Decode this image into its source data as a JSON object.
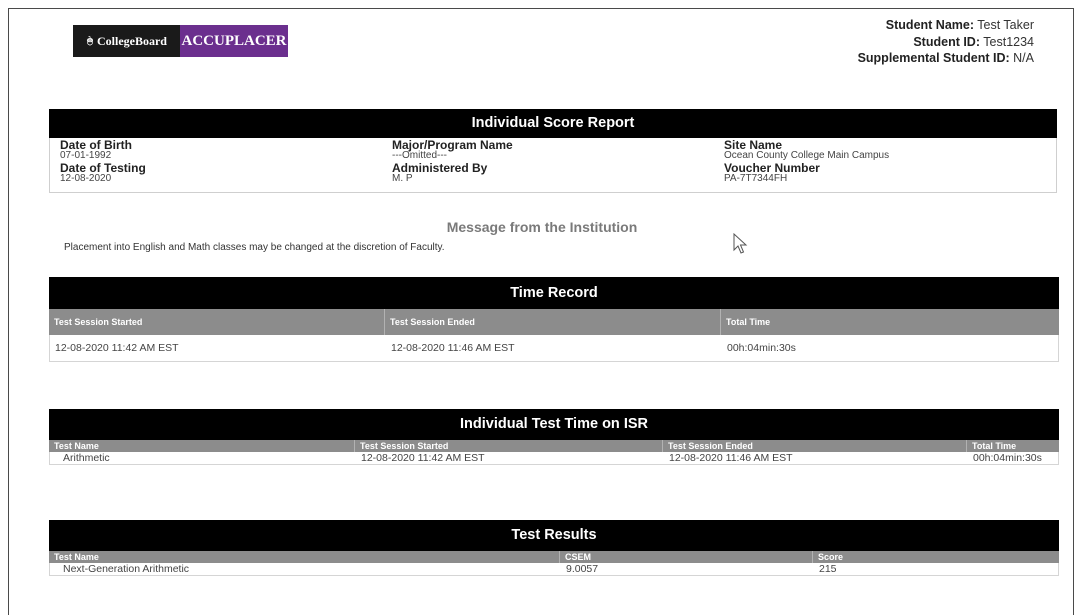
{
  "logo": {
    "collegeboard": "CollegeBoard",
    "accuplacer": "ACCUPLACER"
  },
  "student": {
    "name_label": "Student Name:",
    "name": "Test Taker",
    "id_label": "Student ID:",
    "id": "Test1234",
    "supp_label": "Supplemental Student ID:",
    "supp": "N/A"
  },
  "isr": {
    "title": "Individual Score Report",
    "dob_label": "Date of Birth",
    "dob": "07-01-1992",
    "dot_label": "Date of Testing",
    "dot": "12-08-2020",
    "major_label": "Major/Program Name",
    "major": "---Omitted---",
    "admin_label": "Administered By",
    "admin": "M. P",
    "site_label": "Site Name",
    "site": "Ocean County College Main Campus",
    "voucher_label": "Voucher Number",
    "voucher": "PA-7T7344FH"
  },
  "message": {
    "title": "Message from the Institution",
    "text": "Placement into English and Math classes may be changed at the discretion of Faculty."
  },
  "time_record": {
    "title": "Time Record",
    "headers": [
      "Test Session Started",
      "Test Session Ended",
      "Total Time"
    ],
    "row": [
      "12-08-2020 11:42 AM EST",
      "12-08-2020 11:46 AM EST",
      "00h:04min:30s"
    ]
  },
  "test_time": {
    "title": "Individual Test Time on ISR",
    "headers": [
      "Test Name",
      "Test Session Started",
      "Test Session Ended",
      "Total Time"
    ],
    "row": [
      "Arithmetic",
      "12-08-2020 11:42 AM EST",
      "12-08-2020 11:46 AM EST",
      "00h:04min:30s"
    ]
  },
  "results": {
    "title": "Test Results",
    "headers": [
      "Test Name",
      "CSEM",
      "Score"
    ],
    "row": [
      "Next-Generation Arithmetic",
      "9.0057",
      "215"
    ]
  }
}
